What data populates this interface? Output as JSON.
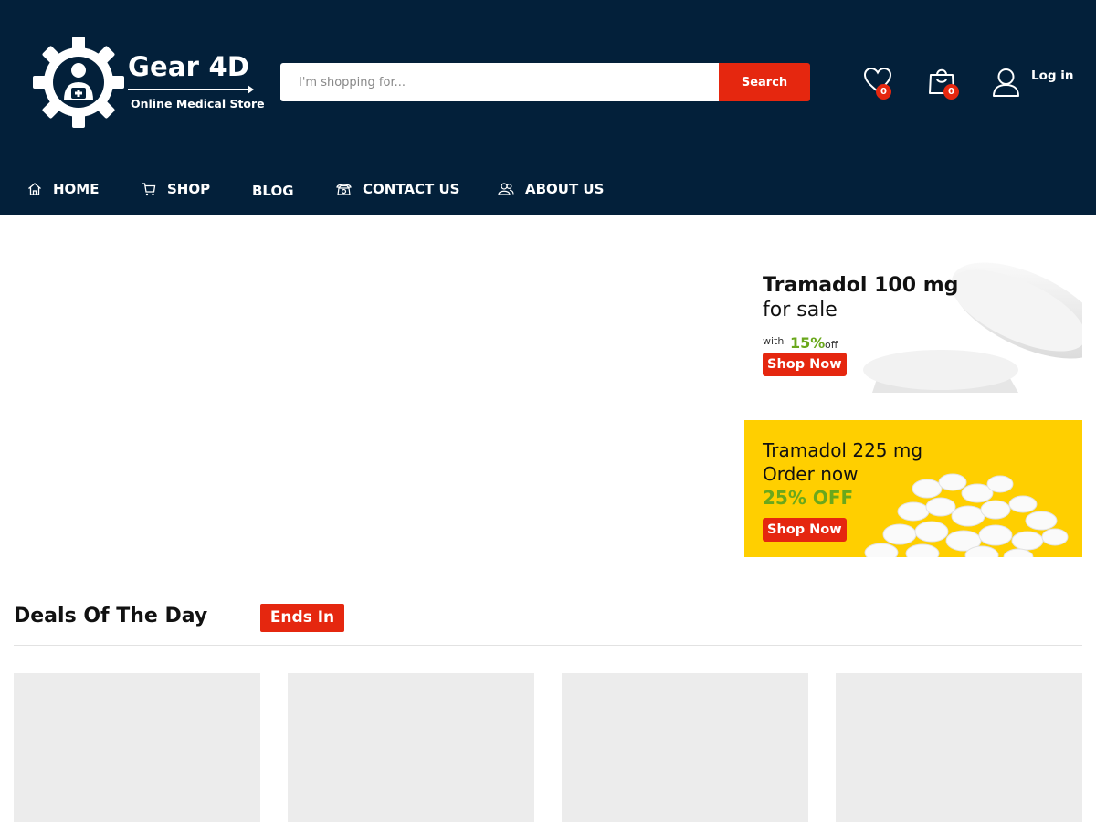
{
  "brand": {
    "name": "Gear 4D",
    "tagline": "Online Medical Store"
  },
  "search": {
    "placeholder": "I'm shopping for...",
    "button_label": "Search"
  },
  "header_actions": {
    "wishlist_count": "0",
    "cart_count": "0",
    "login_label": "Log in"
  },
  "nav": {
    "items": [
      {
        "label": "HOME",
        "icon": "home-icon"
      },
      {
        "label": "SHOP",
        "icon": "cart-icon"
      },
      {
        "label": "BLOG",
        "icon": ""
      },
      {
        "label": "CONTACT US",
        "icon": "phone-icon"
      },
      {
        "label": "ABOUT US",
        "icon": "users-icon"
      }
    ]
  },
  "banners": [
    {
      "title": "Tramadol 100 mg",
      "subtitle": "for sale",
      "with_text": "with",
      "discount": "15%",
      "off_text": "off",
      "button_label": "Shop Now"
    },
    {
      "title": "Tramadol 225 mg",
      "subtitle": "Order now",
      "discount": "25% OFF",
      "button_label": "Shop Now"
    }
  ],
  "deals": {
    "title": "Deals Of The Day",
    "ends_label": "Ends In"
  },
  "colors": {
    "header_bg": "#03203a",
    "accent_red": "#e5270f",
    "accent_green": "#6aa81c",
    "banner_yellow": "#ffcf00",
    "placeholder_gray": "#ececec"
  }
}
